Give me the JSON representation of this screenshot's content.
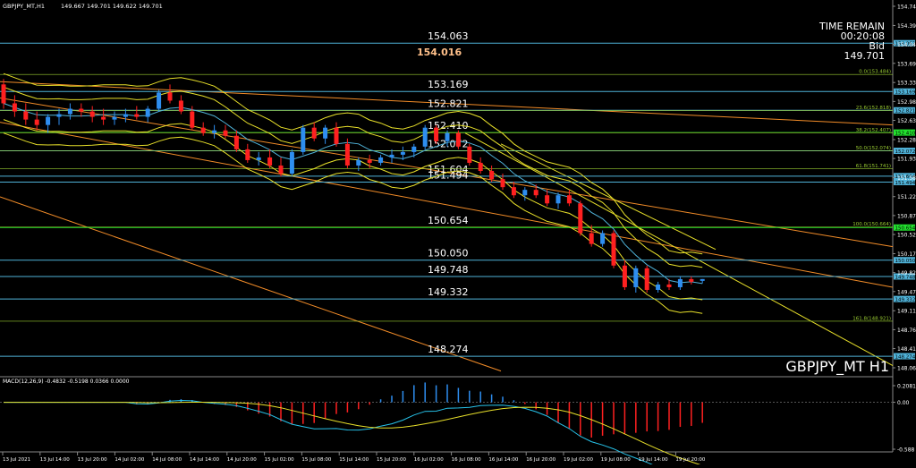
{
  "window": {
    "title": "GBPJPY_MT,H1",
    "ohlc": "149.667 149.701 149.622 149.701",
    "symbol_label": "GBPJPY_MT H1"
  },
  "time_remain": {
    "label": "TIME REMAIN",
    "value": "00:20:08",
    "bid_label": "Bid",
    "bid_value": "149.701"
  },
  "price_axis": {
    "min": 148.06,
    "max": 154.745,
    "ticks": [
      "154.745",
      "154.390",
      "154.040",
      "153.690",
      "153.335",
      "152.985",
      "152.635",
      "152.280",
      "151.930",
      "151.580",
      "151.225",
      "150.875",
      "150.525",
      "150.170",
      "149.820",
      "149.470",
      "149.115",
      "148.765",
      "148.415",
      "148.060"
    ]
  },
  "levels": [
    {
      "label": "154.063",
      "value": 154.063,
      "color": "#4fb2d8"
    },
    {
      "label": "153.169",
      "value": 153.169,
      "color": "#4fb2d8"
    },
    {
      "label": "152.821",
      "value": 152.821,
      "color": "#4fb2d8"
    },
    {
      "label": "152.410",
      "value": 152.41,
      "color": "#22e22e"
    },
    {
      "label": "152.072",
      "value": 152.072,
      "color": "#4fb2d8"
    },
    {
      "label": "151.604",
      "value": 151.604,
      "color": "#4fb2d8"
    },
    {
      "label": "151.494",
      "value": 151.494,
      "color": "#4fb2d8"
    },
    {
      "label": "150.654",
      "value": 150.654,
      "color": "#22e22e"
    },
    {
      "label": "150.050",
      "value": 150.05,
      "color": "#4fb2d8"
    },
    {
      "label": "149.748",
      "value": 149.748,
      "color": "#4fb2d8"
    },
    {
      "label": "149.332",
      "value": 149.332,
      "color": "#4fb2d8"
    },
    {
      "label": "148.274",
      "value": 148.274,
      "color": "#4fb2d8"
    }
  ],
  "highlight_price": {
    "label": "154.016",
    "color": "#ffc08a"
  },
  "fib_levels": [
    {
      "label": "0.0(153.484)",
      "value": 153.484
    },
    {
      "label": "23.6(152.818)",
      "value": 152.818
    },
    {
      "label": "38.2(152.407)",
      "value": 152.407
    },
    {
      "label": "50.0(152.074)",
      "value": 152.074
    },
    {
      "label": "61.8(151.741)",
      "value": 151.741
    },
    {
      "label": "100.0(150.664)",
      "value": 150.664
    },
    {
      "label": "161.8(148.921)",
      "value": 148.921
    }
  ],
  "macd": {
    "label": "MACD(12,26,9) -0.4832 -0.5198 0.0366 0.0000",
    "min": -0.588,
    "max": 0.2081,
    "ticks": [
      "0.2081",
      "0.00",
      "-0.588"
    ]
  },
  "time_axis": [
    "13 Jul 2021",
    "13 Jul 14:00",
    "13 Jul 20:00",
    "14 Jul 02:00",
    "14 Jul 08:00",
    "14 Jul 14:00",
    "14 Jul 20:00",
    "15 Jul 02:00",
    "15 Jul 08:00",
    "15 Jul 14:00",
    "15 Jul 20:00",
    "16 Jul 02:00",
    "16 Jul 08:00",
    "16 Jul 14:00",
    "16 Jul 20:00",
    "19 Jul 02:00",
    "19 Jul 08:00",
    "19 Jul 14:00",
    "19 Jul 20:00"
  ],
  "colors": {
    "up": "#2e8ef0",
    "down": "#ff2020",
    "band": "#e8e02a",
    "trend": "#f28c28",
    "level_blue": "#4fb2d8",
    "level_green": "#22e22e",
    "macd_signal": "#e8e02a",
    "macd_line": "#27c3ea"
  },
  "chart_data": {
    "type": "candlestick",
    "title": "GBPJPY_MT,H1",
    "ylim": [
      148.06,
      154.745
    ],
    "series": [
      {
        "name": "GBPJPY_MT",
        "ohlc": [
          [
            153.3,
            153.4,
            152.85,
            152.95
          ],
          [
            152.95,
            153.1,
            152.7,
            152.8
          ],
          [
            152.8,
            152.95,
            152.55,
            152.65
          ],
          [
            152.65,
            152.8,
            152.45,
            152.55
          ],
          [
            152.55,
            152.75,
            152.4,
            152.7
          ],
          [
            152.7,
            152.85,
            152.55,
            152.75
          ],
          [
            152.75,
            152.95,
            152.65,
            152.85
          ],
          [
            152.85,
            152.95,
            152.7,
            152.8
          ],
          [
            152.8,
            152.9,
            152.6,
            152.7
          ],
          [
            152.7,
            152.85,
            152.55,
            152.65
          ],
          [
            152.65,
            152.8,
            152.55,
            152.7
          ],
          [
            152.7,
            152.85,
            152.6,
            152.75
          ],
          [
            152.75,
            152.9,
            152.65,
            152.7
          ],
          [
            152.7,
            152.9,
            152.6,
            152.85
          ],
          [
            152.85,
            153.2,
            152.8,
            153.15
          ],
          [
            153.15,
            153.3,
            152.95,
            153.0
          ],
          [
            153.0,
            153.1,
            152.75,
            152.8
          ],
          [
            152.8,
            152.9,
            152.45,
            152.5
          ],
          [
            152.5,
            152.6,
            152.35,
            152.4
          ],
          [
            152.4,
            152.55,
            152.3,
            152.45
          ],
          [
            152.45,
            152.55,
            152.3,
            152.35
          ],
          [
            152.35,
            152.45,
            152.05,
            152.1
          ],
          [
            152.1,
            152.2,
            151.85,
            151.9
          ],
          [
            151.9,
            152.05,
            151.8,
            151.95
          ],
          [
            151.95,
            152.1,
            151.75,
            151.8
          ],
          [
            151.8,
            151.95,
            151.6,
            151.65
          ],
          [
            151.65,
            152.1,
            151.6,
            152.05
          ],
          [
            152.05,
            152.55,
            152.0,
            152.5
          ],
          [
            152.5,
            152.6,
            152.25,
            152.3
          ],
          [
            152.3,
            152.55,
            152.2,
            152.5
          ],
          [
            152.5,
            152.6,
            152.15,
            152.2
          ],
          [
            152.2,
            152.3,
            151.75,
            151.8
          ],
          [
            151.8,
            151.95,
            151.7,
            151.9
          ],
          [
            151.9,
            152.0,
            151.75,
            151.85
          ],
          [
            151.85,
            152.0,
            151.8,
            151.95
          ],
          [
            151.95,
            152.1,
            151.85,
            152.0
          ],
          [
            152.0,
            152.15,
            151.9,
            152.05
          ],
          [
            152.05,
            152.2,
            151.95,
            152.15
          ],
          [
            152.15,
            152.55,
            152.1,
            152.5
          ],
          [
            152.5,
            152.55,
            152.2,
            152.25
          ],
          [
            152.25,
            152.45,
            152.15,
            152.4
          ],
          [
            152.4,
            152.45,
            152.1,
            152.15
          ],
          [
            152.15,
            152.2,
            151.8,
            151.85
          ],
          [
            151.85,
            151.95,
            151.65,
            151.7
          ],
          [
            151.7,
            151.8,
            151.5,
            151.55
          ],
          [
            151.55,
            151.65,
            151.35,
            151.4
          ],
          [
            151.4,
            151.5,
            151.2,
            151.25
          ],
          [
            151.25,
            151.4,
            151.15,
            151.35
          ],
          [
            151.35,
            151.45,
            151.2,
            151.25
          ],
          [
            151.25,
            151.35,
            151.05,
            151.1
          ],
          [
            151.1,
            151.3,
            151.0,
            151.25
          ],
          [
            151.25,
            151.35,
            151.05,
            151.1
          ],
          [
            151.1,
            151.15,
            150.5,
            150.55
          ],
          [
            150.55,
            150.7,
            150.3,
            150.35
          ],
          [
            150.35,
            150.6,
            150.3,
            150.55
          ],
          [
            150.55,
            150.6,
            149.9,
            149.95
          ],
          [
            149.95,
            150.05,
            149.5,
            149.55
          ],
          [
            149.55,
            149.95,
            149.45,
            149.9
          ],
          [
            149.9,
            149.95,
            149.45,
            149.5
          ],
          [
            149.5,
            149.65,
            149.45,
            149.6
          ],
          [
            149.6,
            149.7,
            149.5,
            149.55
          ],
          [
            149.55,
            149.75,
            149.5,
            149.7
          ],
          [
            149.7,
            149.75,
            149.6,
            149.65
          ],
          [
            149.667,
            149.701,
            149.622,
            149.701
          ]
        ]
      }
    ]
  }
}
